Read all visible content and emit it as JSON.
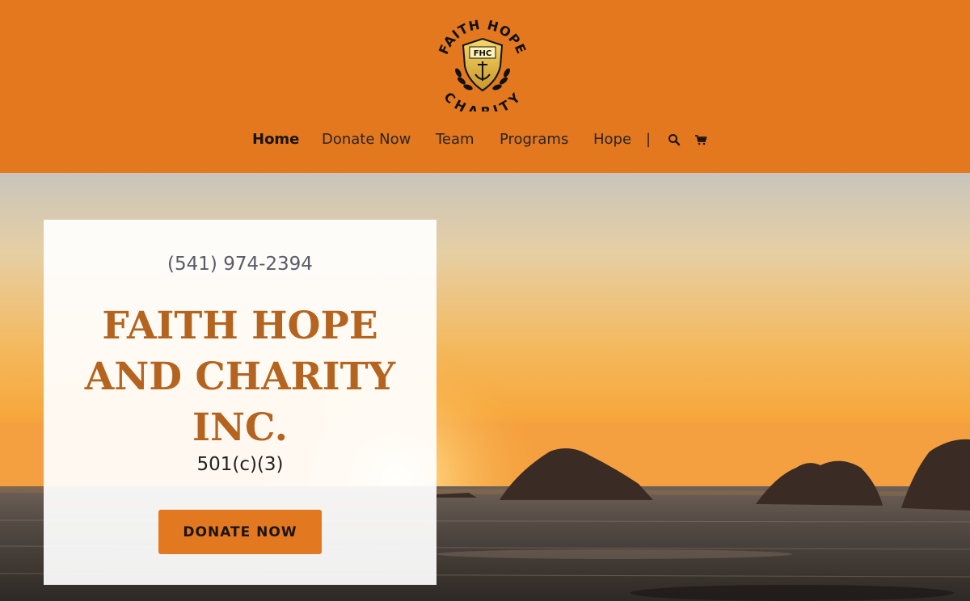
{
  "brand": {
    "logo_top_text": "FAITH HOPE",
    "logo_bottom_text": "CHARITY",
    "logo_initials": "FHC"
  },
  "nav": {
    "items": [
      {
        "label": "Home",
        "active": true
      },
      {
        "label": "Donate Now",
        "active": false
      },
      {
        "label": "Team",
        "active": false
      },
      {
        "label": "Programs",
        "active": false
      },
      {
        "label": "Hope",
        "active": false
      }
    ],
    "separator": "|",
    "icons": [
      "search-icon",
      "cart-icon"
    ]
  },
  "hero": {
    "phone": "(541) 974-2394",
    "title_lines": [
      "FAITH HOPE",
      "AND CHARITY",
      "INC."
    ],
    "subtitle": "501(c)(3)",
    "cta_label": "DONATE NOW"
  },
  "colors": {
    "header_bg": "#e3781f",
    "accent": "#e2781f",
    "title": "#b5641f"
  }
}
